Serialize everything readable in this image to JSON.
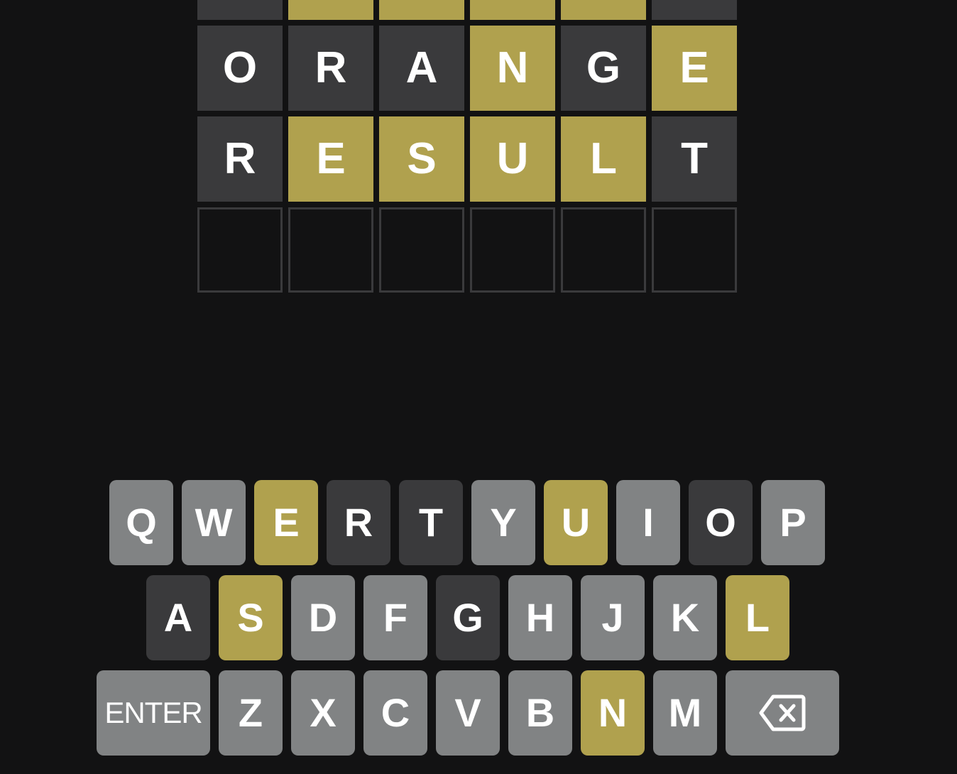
{
  "board": {
    "rows": [
      {
        "name": "partial-row",
        "tiles": [
          {
            "letter": "",
            "state": "absent"
          },
          {
            "letter": "",
            "state": "present"
          },
          {
            "letter": "",
            "state": "present"
          },
          {
            "letter": "",
            "state": "present"
          },
          {
            "letter": "",
            "state": "present"
          },
          {
            "letter": "",
            "state": "absent"
          }
        ]
      },
      {
        "name": "guess-orange",
        "tiles": [
          {
            "letter": "O",
            "state": "absent"
          },
          {
            "letter": "R",
            "state": "absent"
          },
          {
            "letter": "A",
            "state": "absent"
          },
          {
            "letter": "N",
            "state": "present"
          },
          {
            "letter": "G",
            "state": "absent"
          },
          {
            "letter": "E",
            "state": "present"
          }
        ]
      },
      {
        "name": "guess-result",
        "tiles": [
          {
            "letter": "R",
            "state": "absent"
          },
          {
            "letter": "E",
            "state": "present"
          },
          {
            "letter": "S",
            "state": "present"
          },
          {
            "letter": "U",
            "state": "present"
          },
          {
            "letter": "L",
            "state": "present"
          },
          {
            "letter": "T",
            "state": "absent"
          }
        ]
      },
      {
        "name": "empty-row",
        "tiles": [
          {
            "letter": "",
            "state": "empty"
          },
          {
            "letter": "",
            "state": "empty"
          },
          {
            "letter": "",
            "state": "empty"
          },
          {
            "letter": "",
            "state": "empty"
          },
          {
            "letter": "",
            "state": "empty"
          },
          {
            "letter": "",
            "state": "empty"
          }
        ]
      }
    ]
  },
  "keyboard": {
    "row1": [
      {
        "label": "Q",
        "state": "unused"
      },
      {
        "label": "W",
        "state": "unused"
      },
      {
        "label": "E",
        "state": "present"
      },
      {
        "label": "R",
        "state": "absent"
      },
      {
        "label": "T",
        "state": "absent"
      },
      {
        "label": "Y",
        "state": "unused"
      },
      {
        "label": "U",
        "state": "present"
      },
      {
        "label": "I",
        "state": "unused"
      },
      {
        "label": "O",
        "state": "absent"
      },
      {
        "label": "P",
        "state": "unused"
      }
    ],
    "row2": [
      {
        "label": "A",
        "state": "absent"
      },
      {
        "label": "S",
        "state": "present"
      },
      {
        "label": "D",
        "state": "unused"
      },
      {
        "label": "F",
        "state": "unused"
      },
      {
        "label": "G",
        "state": "absent"
      },
      {
        "label": "H",
        "state": "unused"
      },
      {
        "label": "J",
        "state": "unused"
      },
      {
        "label": "K",
        "state": "unused"
      },
      {
        "label": "L",
        "state": "present"
      }
    ],
    "row3": [
      {
        "label": "ENTER",
        "state": "unused",
        "kind": "enter"
      },
      {
        "label": "Z",
        "state": "unused"
      },
      {
        "label": "X",
        "state": "unused"
      },
      {
        "label": "C",
        "state": "unused"
      },
      {
        "label": "V",
        "state": "unused"
      },
      {
        "label": "B",
        "state": "unused"
      },
      {
        "label": "N",
        "state": "present"
      },
      {
        "label": "M",
        "state": "unused"
      },
      {
        "label": "",
        "state": "unused",
        "kind": "backspace",
        "icon": "backspace-icon"
      }
    ]
  },
  "colors": {
    "background": "#121213",
    "absent": "#3a3a3c",
    "present": "#b0a14e",
    "unused_key": "#818384",
    "text": "#ffffff"
  }
}
